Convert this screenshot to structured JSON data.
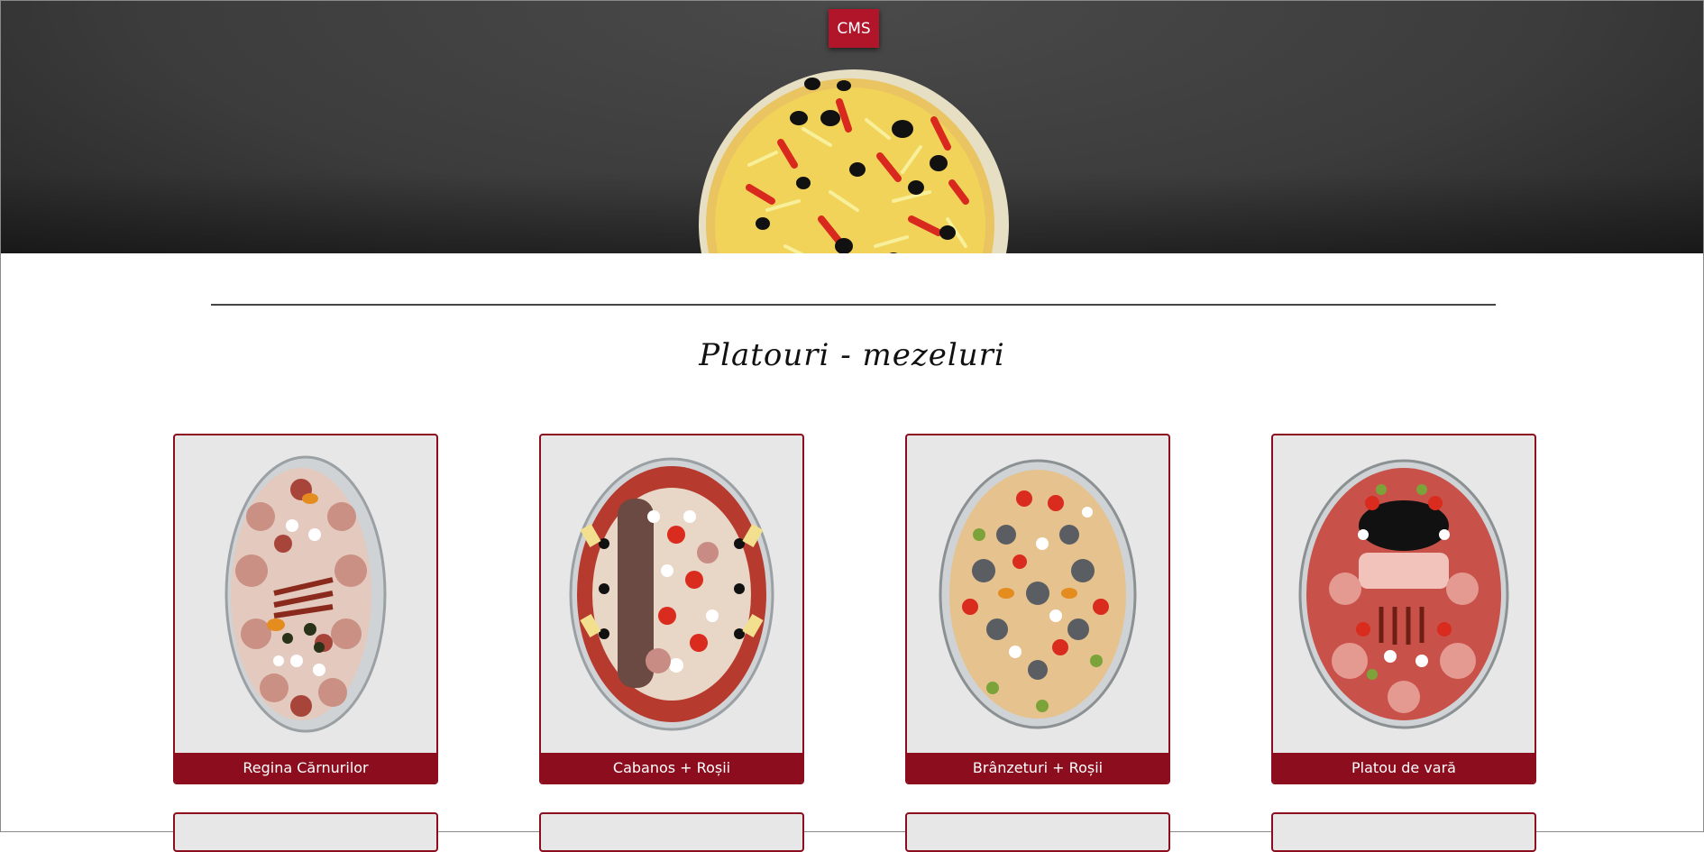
{
  "header": {
    "cms_label": "CMS",
    "hero_image": "pizza-image"
  },
  "section": {
    "title": "Platouri - mezeluri"
  },
  "products": [
    {
      "name": "Regina Cărnurilor",
      "image": "platter-image"
    },
    {
      "name": "Cabanos + Roșii",
      "image": "platter-image"
    },
    {
      "name": "Brânzeturi + Roșii",
      "image": "platter-image"
    },
    {
      "name": "Platou de vară",
      "image": "platter-image"
    }
  ],
  "colors": {
    "accent": "#8b0d1e",
    "cms_button": "#b0152a",
    "hero_background": "#3c3c3c",
    "card_background": "#e7e7e7"
  }
}
